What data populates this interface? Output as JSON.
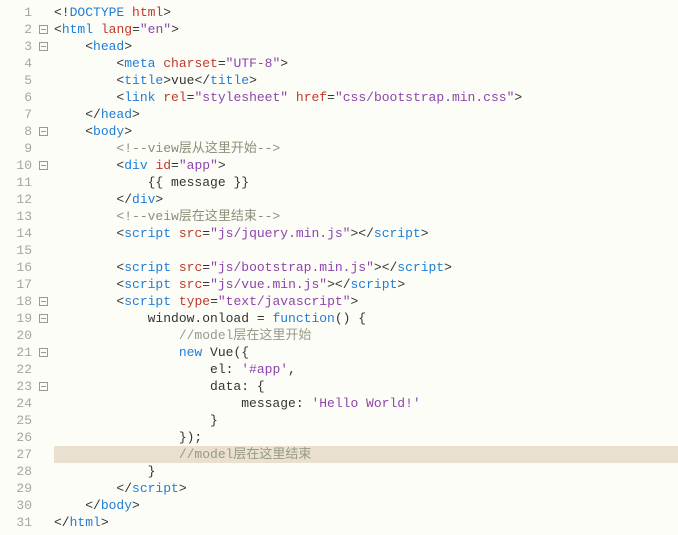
{
  "lines": [
    {
      "n": 1,
      "fold": false,
      "hl": false,
      "segs": [
        [
          0,
          "<!"
        ],
        [
          1,
          "DOCTYPE"
        ],
        [
          0,
          " "
        ],
        [
          2,
          "html"
        ],
        [
          0,
          ">"
        ]
      ]
    },
    {
      "n": 2,
      "fold": true,
      "hl": false,
      "segs": [
        [
          0,
          "<"
        ],
        [
          1,
          "html"
        ],
        [
          0,
          " "
        ],
        [
          2,
          "lang"
        ],
        [
          0,
          "="
        ],
        [
          3,
          "\"en\""
        ],
        [
          0,
          ">"
        ]
      ]
    },
    {
      "n": 3,
      "fold": true,
      "hl": false,
      "segs": [
        [
          0,
          "    <"
        ],
        [
          1,
          "head"
        ],
        [
          0,
          ">"
        ]
      ]
    },
    {
      "n": 4,
      "fold": false,
      "hl": false,
      "segs": [
        [
          0,
          "        <"
        ],
        [
          1,
          "meta"
        ],
        [
          0,
          " "
        ],
        [
          2,
          "charset"
        ],
        [
          0,
          "="
        ],
        [
          3,
          "\"UTF-8\""
        ],
        [
          0,
          ">"
        ]
      ]
    },
    {
      "n": 5,
      "fold": false,
      "hl": false,
      "segs": [
        [
          0,
          "        <"
        ],
        [
          1,
          "title"
        ],
        [
          0,
          ">"
        ],
        [
          4,
          "vue"
        ],
        [
          0,
          "</"
        ],
        [
          1,
          "title"
        ],
        [
          0,
          ">"
        ]
      ]
    },
    {
      "n": 6,
      "fold": false,
      "hl": false,
      "segs": [
        [
          0,
          "        <"
        ],
        [
          1,
          "link"
        ],
        [
          0,
          " "
        ],
        [
          2,
          "rel"
        ],
        [
          0,
          "="
        ],
        [
          3,
          "\"stylesheet\""
        ],
        [
          0,
          " "
        ],
        [
          2,
          "href"
        ],
        [
          0,
          "="
        ],
        [
          3,
          "\"css/bootstrap.min.css\""
        ],
        [
          0,
          ">"
        ]
      ]
    },
    {
      "n": 7,
      "fold": false,
      "hl": false,
      "segs": [
        [
          0,
          "    </"
        ],
        [
          1,
          "head"
        ],
        [
          0,
          ">"
        ]
      ]
    },
    {
      "n": 8,
      "fold": true,
      "hl": false,
      "segs": [
        [
          0,
          "    <"
        ],
        [
          1,
          "body"
        ],
        [
          0,
          ">"
        ]
      ]
    },
    {
      "n": 9,
      "fold": false,
      "hl": false,
      "segs": [
        [
          0,
          "        "
        ],
        [
          5,
          "<!--view层从这里开始-->"
        ]
      ]
    },
    {
      "n": 10,
      "fold": true,
      "hl": false,
      "segs": [
        [
          0,
          "        <"
        ],
        [
          1,
          "div"
        ],
        [
          0,
          " "
        ],
        [
          2,
          "id"
        ],
        [
          0,
          "="
        ],
        [
          3,
          "\"app\""
        ],
        [
          0,
          ">"
        ]
      ]
    },
    {
      "n": 11,
      "fold": false,
      "hl": false,
      "segs": [
        [
          0,
          "            "
        ],
        [
          4,
          "{{ message }}"
        ]
      ]
    },
    {
      "n": 12,
      "fold": false,
      "hl": false,
      "segs": [
        [
          0,
          "        </"
        ],
        [
          1,
          "div"
        ],
        [
          0,
          ">"
        ]
      ]
    },
    {
      "n": 13,
      "fold": false,
      "hl": false,
      "segs": [
        [
          0,
          "        "
        ],
        [
          5,
          "<!--veiw层在这里结束-->"
        ]
      ]
    },
    {
      "n": 14,
      "fold": false,
      "hl": false,
      "segs": [
        [
          0,
          "        <"
        ],
        [
          1,
          "script"
        ],
        [
          0,
          " "
        ],
        [
          2,
          "src"
        ],
        [
          0,
          "="
        ],
        [
          3,
          "\"js/jquery.min.js\""
        ],
        [
          0,
          "></"
        ],
        [
          1,
          "script"
        ],
        [
          0,
          ">"
        ]
      ]
    },
    {
      "n": 15,
      "fold": false,
      "hl": false,
      "segs": [
        [
          0,
          ""
        ]
      ]
    },
    {
      "n": 16,
      "fold": false,
      "hl": false,
      "segs": [
        [
          0,
          "        <"
        ],
        [
          1,
          "script"
        ],
        [
          0,
          " "
        ],
        [
          2,
          "src"
        ],
        [
          0,
          "="
        ],
        [
          3,
          "\"js/bootstrap.min.js\""
        ],
        [
          0,
          "></"
        ],
        [
          1,
          "script"
        ],
        [
          0,
          ">"
        ]
      ]
    },
    {
      "n": 17,
      "fold": false,
      "hl": false,
      "segs": [
        [
          0,
          "        <"
        ],
        [
          1,
          "script"
        ],
        [
          0,
          " "
        ],
        [
          2,
          "src"
        ],
        [
          0,
          "="
        ],
        [
          3,
          "\"js/vue.min.js\""
        ],
        [
          0,
          "></"
        ],
        [
          1,
          "script"
        ],
        [
          0,
          ">"
        ]
      ]
    },
    {
      "n": 18,
      "fold": true,
      "hl": false,
      "segs": [
        [
          0,
          "        <"
        ],
        [
          1,
          "script"
        ],
        [
          0,
          " "
        ],
        [
          2,
          "type"
        ],
        [
          0,
          "="
        ],
        [
          3,
          "\"text/javascript\""
        ],
        [
          0,
          ">"
        ]
      ]
    },
    {
      "n": 19,
      "fold": true,
      "hl": false,
      "segs": [
        [
          4,
          "            window.onload = "
        ],
        [
          6,
          "function"
        ],
        [
          4,
          "() {"
        ]
      ]
    },
    {
      "n": 20,
      "fold": false,
      "hl": false,
      "segs": [
        [
          4,
          "                "
        ],
        [
          7,
          "//model层在这里开始"
        ]
      ]
    },
    {
      "n": 21,
      "fold": true,
      "hl": false,
      "segs": [
        [
          4,
          "                "
        ],
        [
          6,
          "new"
        ],
        [
          4,
          " Vue({"
        ]
      ]
    },
    {
      "n": 22,
      "fold": false,
      "hl": false,
      "segs": [
        [
          4,
          "                    el: "
        ],
        [
          3,
          "'#app'"
        ],
        [
          4,
          ","
        ]
      ]
    },
    {
      "n": 23,
      "fold": true,
      "hl": false,
      "segs": [
        [
          4,
          "                    data: {"
        ]
      ]
    },
    {
      "n": 24,
      "fold": false,
      "hl": false,
      "segs": [
        [
          4,
          "                        message: "
        ],
        [
          3,
          "'Hello World!'"
        ]
      ]
    },
    {
      "n": 25,
      "fold": false,
      "hl": false,
      "segs": [
        [
          4,
          "                    }"
        ]
      ]
    },
    {
      "n": 26,
      "fold": false,
      "hl": false,
      "segs": [
        [
          4,
          "                });"
        ]
      ]
    },
    {
      "n": 27,
      "fold": false,
      "hl": true,
      "segs": [
        [
          4,
          "                "
        ],
        [
          7,
          "//model层在这里结束"
        ]
      ]
    },
    {
      "n": 28,
      "fold": false,
      "hl": false,
      "segs": [
        [
          4,
          "            }"
        ]
      ]
    },
    {
      "n": 29,
      "fold": false,
      "hl": false,
      "segs": [
        [
          0,
          "        </"
        ],
        [
          1,
          "script"
        ],
        [
          0,
          ">"
        ]
      ]
    },
    {
      "n": 30,
      "fold": false,
      "hl": false,
      "segs": [
        [
          0,
          "    </"
        ],
        [
          1,
          "body"
        ],
        [
          0,
          ">"
        ]
      ]
    },
    {
      "n": 31,
      "fold": false,
      "hl": false,
      "segs": [
        [
          0,
          "</"
        ],
        [
          1,
          "html"
        ],
        [
          0,
          ">"
        ]
      ]
    }
  ],
  "classes": [
    "t-punc",
    "t-tag",
    "t-attr",
    "t-str",
    "t-txt",
    "t-cmt",
    "t-kw",
    "t-cmt-cn"
  ]
}
